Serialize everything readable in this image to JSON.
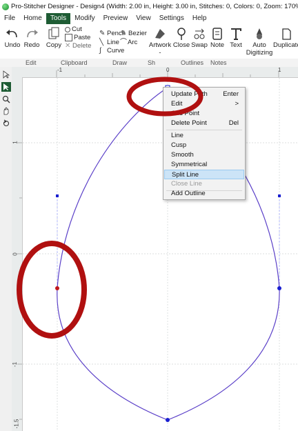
{
  "window": {
    "title": "Pro-Stitcher Designer - Design4 (Width: 2.00 in, Height: 3.00 in, Stitches: 0, Colors: 0, Zoom: 170%)"
  },
  "menubar": {
    "items": [
      "File",
      "Home",
      "Tools",
      "Modify",
      "Preview",
      "View",
      "Settings",
      "Help"
    ],
    "active": "Tools"
  },
  "ribbon": {
    "undo": "Undo",
    "redo": "Redo",
    "copy": "Copy",
    "cut": "Cut",
    "paste": "Paste",
    "delete": "Delete",
    "pencil": "Pencil",
    "bezier": "Bezier",
    "line": "Line",
    "arc": "Arc",
    "curve": "Curve",
    "artwork": "Artwork",
    "artwork_suffix": "-",
    "close": "Close",
    "swap": "Swap",
    "note": "Note",
    "text": "Text",
    "auto_digitizing": [
      "Auto",
      "Digitizing"
    ],
    "duplicate": "Duplicate"
  },
  "groups": {
    "edit": "Edit",
    "clipboard": "Clipboard",
    "draw": "Draw",
    "shapes": "Sh",
    "outlines": "Outlines",
    "notes": "Notes"
  },
  "rulers": {
    "h_labels": [
      "-1",
      "0",
      "1"
    ],
    "v_labels": [
      "1",
      "0",
      "-1",
      "-1.5"
    ]
  },
  "context_menu": {
    "items": [
      {
        "label": "Update Path",
        "shortcut": "Enter",
        "state": "normal"
      },
      {
        "label": "Edit",
        "shortcut": ">",
        "state": "normal"
      },
      {
        "label": "Add Point",
        "shortcut": "",
        "state": "normal"
      },
      {
        "label": "Delete Point",
        "shortcut": "Del",
        "state": "normal"
      },
      {
        "label": "Line",
        "shortcut": "",
        "state": "normal"
      },
      {
        "label": "Cusp",
        "shortcut": "",
        "state": "normal"
      },
      {
        "label": "Smooth",
        "shortcut": "",
        "state": "normal"
      },
      {
        "label": "Symmetrical",
        "shortcut": "",
        "state": "normal"
      },
      {
        "label": "Split Line",
        "shortcut": "",
        "state": "highlighted"
      },
      {
        "label": "Close Line",
        "shortcut": "",
        "state": "disabled"
      },
      {
        "label": "Add Outline",
        "shortcut": "",
        "state": "normal"
      }
    ]
  },
  "colors": {
    "active_menu": "#1e5c34",
    "path": "#5a3fc8",
    "node": "#1a1fd0",
    "selected_node": "#c0171c",
    "annotation": "#b01010"
  },
  "icons": [
    "undo-icon",
    "redo-icon",
    "copy-icon",
    "cut-icon",
    "paste-icon",
    "delete-icon",
    "pencil-icon",
    "bezier-icon",
    "line-icon",
    "arc-icon",
    "curve-icon",
    "artwork-icon",
    "close-icon",
    "swap-icon",
    "note-icon",
    "text-icon",
    "auto-digitizing-icon",
    "duplicate-icon",
    "select-arrow-icon",
    "node-edit-icon",
    "zoom-icon",
    "pan-hand-icon",
    "rotate-icon"
  ]
}
